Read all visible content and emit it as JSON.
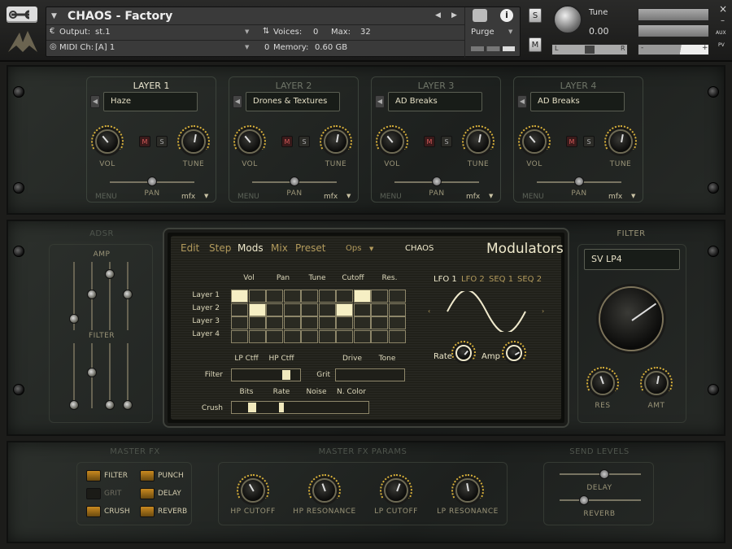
{
  "header": {
    "title": "CHAOS - Factory",
    "output_label": "Output:",
    "output_value": "st.1",
    "midi_label": "MIDI Ch:",
    "midi_value": "[A]  1",
    "voices_label": "Voices:",
    "voices_value": "0",
    "max_label": "Max:",
    "max_value": "32",
    "memory_label": "Memory:",
    "memory_value": "0.60 GB",
    "purge_label": "Purge",
    "solo_label": "S",
    "mute_label": "M",
    "tune_label": "Tune",
    "tune_value": "0.00",
    "pan_left": "L",
    "pan_right": "R",
    "aux_label": "AUX",
    "pv_label": "PV",
    "close": "×",
    "minimize": "–",
    "minus": "-",
    "plus": "+"
  },
  "layers": [
    {
      "title": "LAYER 1",
      "preset": "Haze",
      "vol": "VOL",
      "tune": "TUNE",
      "pan": "PAN",
      "menu": "MENU",
      "mfx": "mfx",
      "mute": "M",
      "solo": "S",
      "pan_value": 0.5,
      "active": true
    },
    {
      "title": "LAYER 2",
      "preset": "Drones & Textures",
      "vol": "VOL",
      "tune": "TUNE",
      "pan": "PAN",
      "menu": "MENU",
      "mfx": "mfx",
      "mute": "M",
      "solo": "S",
      "pan_value": 0.5,
      "active": false
    },
    {
      "title": "LAYER 3",
      "preset": "AD Breaks",
      "vol": "VOL",
      "tune": "TUNE",
      "pan": "PAN",
      "menu": "MENU",
      "mfx": "mfx",
      "mute": "M",
      "solo": "S",
      "pan_value": 0.5,
      "active": false
    },
    {
      "title": "LAYER 4",
      "preset": "AD Breaks",
      "vol": "VOL",
      "tune": "TUNE",
      "pan": "PAN",
      "menu": "MENU",
      "mfx": "mfx",
      "mute": "M",
      "solo": "S",
      "pan_value": 0.5,
      "active": false
    }
  ],
  "adsr": {
    "title": "ADSR",
    "amp": "AMP",
    "filter": "FILTER"
  },
  "screen": {
    "tabs": [
      "Edit",
      "Step",
      "Mods",
      "Mix",
      "Preset"
    ],
    "active_tab": "Mods",
    "ops": "Ops",
    "chaos": "CHAOS",
    "heading": "Modulators",
    "matrix_cols": [
      "Vol",
      "Pan",
      "Tune",
      "Cutoff",
      "Res."
    ],
    "matrix_rows": [
      "Layer 1",
      "Layer 2",
      "Layer 3",
      "Layer 4"
    ],
    "lfo_tabs": [
      "LFO 1",
      "LFO 2",
      "SEQ 1",
      "SEQ 2"
    ],
    "rate": "Rate",
    "amp": "Amp",
    "filter_label": "Filter",
    "lp_ctff": "LP Ctff",
    "hp_ctff": "HP Ctff",
    "grit_label": "Grit",
    "drive": "Drive",
    "tone": "Tone",
    "crush_label": "Crush",
    "bits": "Bits",
    "rate2": "Rate",
    "noise": "Noise",
    "ncolor": "N. Color"
  },
  "filter_panel": {
    "title": "FILTER",
    "type": "SV LP4",
    "res": "RES",
    "amt": "AMT"
  },
  "master_fx": {
    "title": "MASTER FX",
    "items": [
      {
        "label": "FILTER",
        "on": true
      },
      {
        "label": "GRIT",
        "on": false
      },
      {
        "label": "CRUSH",
        "on": true
      },
      {
        "label": "PUNCH",
        "on": true
      },
      {
        "label": "DELAY",
        "on": true
      },
      {
        "label": "REVERB",
        "on": true
      }
    ]
  },
  "master_fx_params": {
    "title": "MASTER FX PARAMS",
    "knobs": [
      "HP CUTOFF",
      "HP RESONANCE",
      "LP CUTOFF",
      "LP RESONANCE"
    ]
  },
  "send_levels": {
    "title": "SEND LEVELS",
    "delay": "DELAY",
    "reverb": "REVERB",
    "delay_value": 0.55,
    "reverb_value": 0.3
  },
  "colors": {
    "accent": "#d8b03a",
    "screen_text": "#efe9cc",
    "led_on": "#c98a20"
  }
}
